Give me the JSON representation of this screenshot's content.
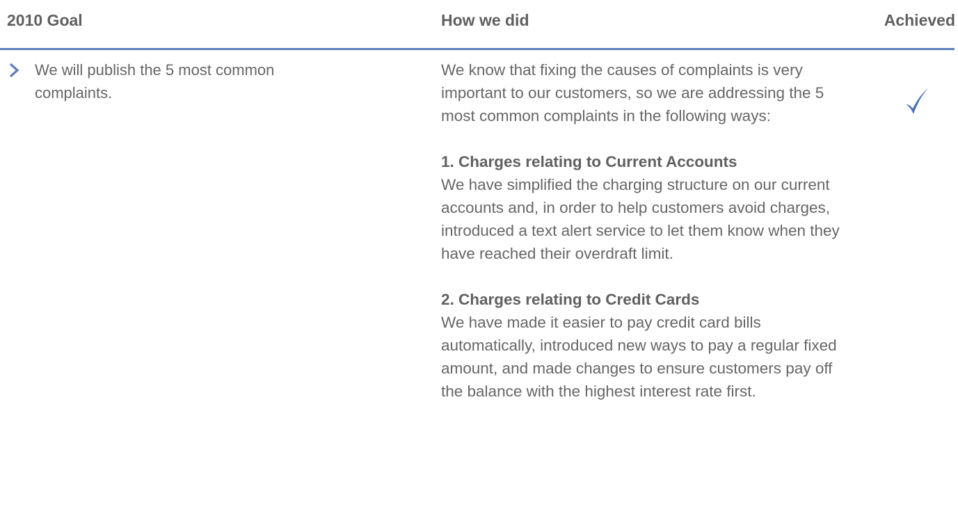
{
  "header": {
    "goal_label": "2010 Goal",
    "how_label": "How we did",
    "achieved_label": "Achieved"
  },
  "goal": {
    "text": "We will publish the 5 most common complaints.",
    "icon": "chevron-right-icon"
  },
  "how_we_did": {
    "intro": "We know that fixing the causes of complaints is very important to our customers, so we are addressing the 5 most common complaints in the following ways:",
    "sections": [
      {
        "title": "1. Charges relating to Current Accounts",
        "body": "We have simplified the charging structure on our current accounts and, in order to help customers avoid charges, introduced a text alert service to let them know when they have reached their overdraft limit."
      },
      {
        "title": "2. Charges relating to Credit Cards",
        "body": "We have made it easier to pay credit card bills automatically, introduced new ways to pay a regular fixed amount, and made changes to ensure customers pay off the balance with the highest interest rate first."
      }
    ]
  },
  "achieved": {
    "icon": "checkmark-icon",
    "status": "achieved"
  },
  "colors": {
    "accent": "#5f7fb9",
    "text": "#666666",
    "heading": "#5f5f5f"
  }
}
